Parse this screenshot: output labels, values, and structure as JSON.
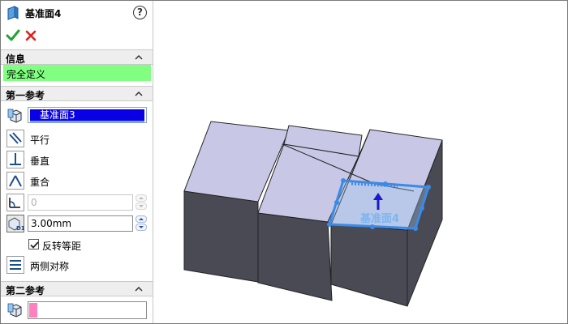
{
  "panel": {
    "title": "基准面4",
    "help_glyph": "?",
    "info_section": {
      "title": "信息",
      "status": "完全定义"
    },
    "first_reference": {
      "title": "第一参考",
      "selected": "基准面3",
      "options": [
        "平行",
        "垂直",
        "重合"
      ],
      "angle_value": "0",
      "distance_value": "3.00mm",
      "flip_label": "反转等距",
      "flip_checked": true,
      "symmetric_label": "两侧对称"
    },
    "second_reference": {
      "title": "第二参考",
      "selected": ""
    }
  },
  "viewport": {
    "plane_label": "基准面4"
  },
  "colors": {
    "status_green": "#80ff80",
    "selection_blue": "#0a00e6",
    "second_ref_pink": "#ff7fbf",
    "plane_preview": "#3b8be6",
    "face_top": "#c8c8e6",
    "face_side": "#4a4a55"
  }
}
